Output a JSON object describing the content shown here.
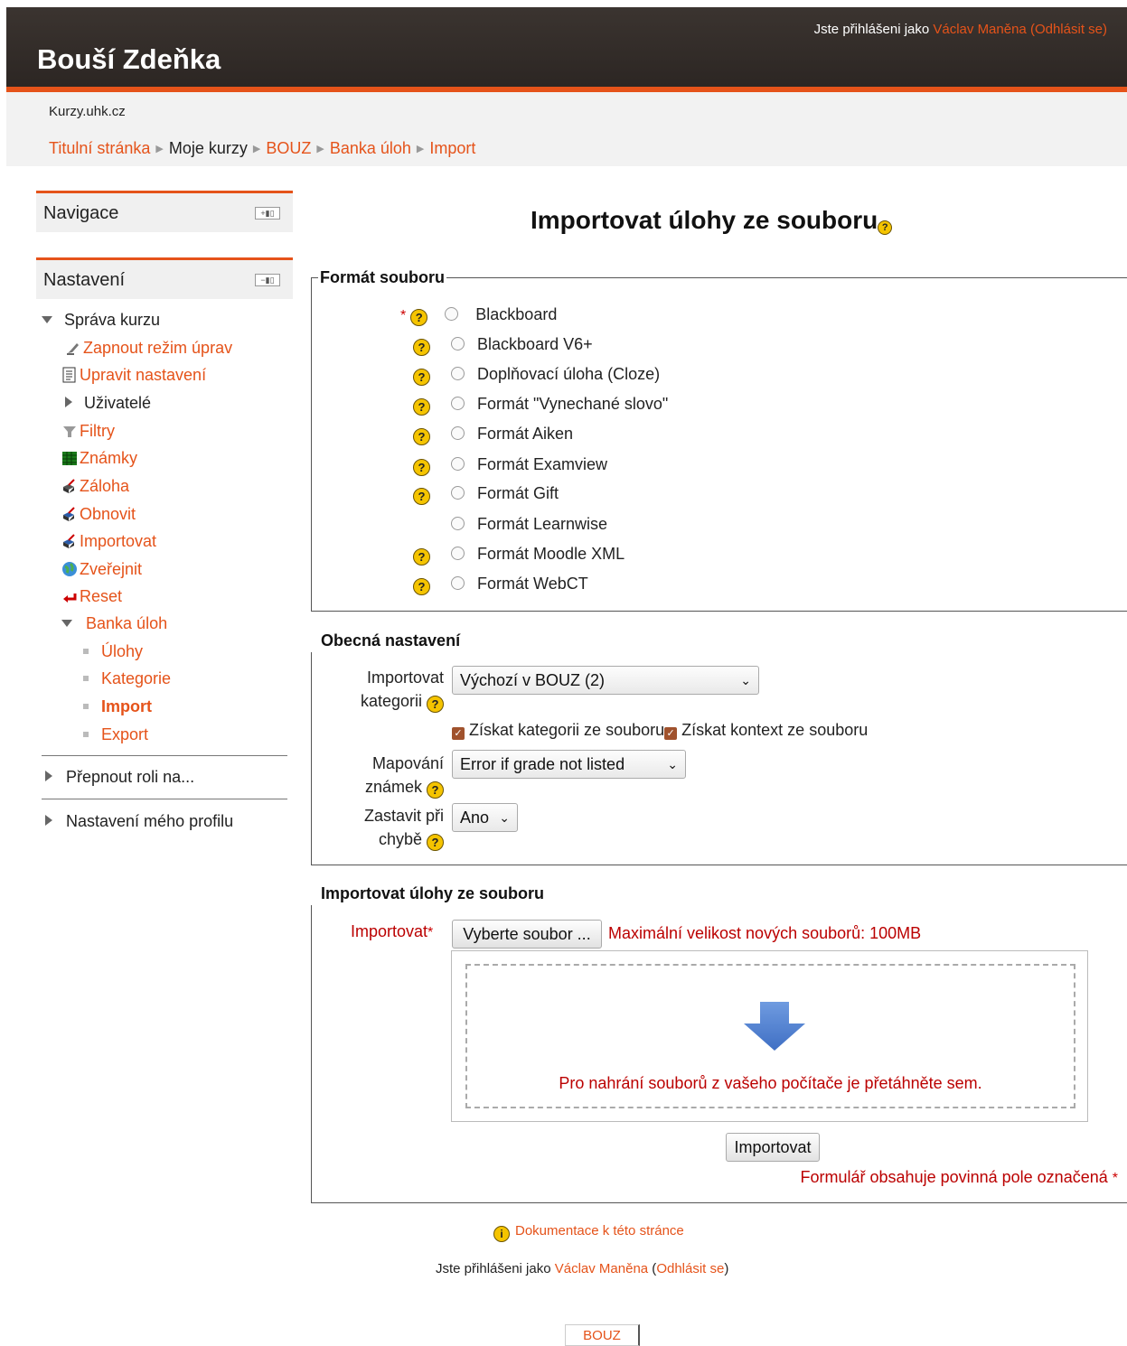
{
  "header": {
    "site_title": "Bouší Zdeňka",
    "login_prefix": "Jste přihlášeni jako ",
    "user_name": "Václav Maněna",
    "logout_open": "(",
    "logout": "Odhlásit se",
    "logout_close": ")"
  },
  "site_short": "Kurzy.uhk.cz",
  "breadcrumb": [
    "Titulní stránka",
    "Moje kurzy",
    "BOUZ",
    "Banka úloh",
    "Import"
  ],
  "blocks": {
    "navigation_title": "Navigace",
    "settings_title": "Nastavení",
    "settings_tree": {
      "course_admin": "Správa kurzu",
      "items": [
        "Zapnout režim úprav",
        "Upravit nastavení",
        "Uživatelé",
        "Filtry",
        "Známky",
        "Záloha",
        "Obnovit",
        "Importovat",
        "Zveřejnit",
        "Reset"
      ],
      "question_bank": "Banka úloh",
      "qb_items": [
        "Úlohy",
        "Kategorie",
        "Import",
        "Export"
      ],
      "switch_role": "Přepnout roli na...",
      "profile_settings": "Nastavení mého profilu"
    }
  },
  "page": {
    "title": "Importovat úlohy ze souboru",
    "file_format": {
      "legend": "Formát souboru",
      "options": [
        "Blackboard",
        "Blackboard V6+",
        "Doplňovací úloha (Cloze)",
        "Formát \"Vynechané slovo\"",
        "Formát Aiken",
        "Formát Examview",
        "Formát Gift",
        "Formát Learnwise",
        "Formát Moodle XML",
        "Formát WebCT"
      ]
    },
    "general": {
      "legend": "Obecná nastavení",
      "import_category_label_1": "Importovat",
      "import_category_label_2": "kategorii",
      "import_category_value": "Výchozí v BOUZ (2)",
      "get_category_from_file": "Získat kategorii ze souboru",
      "get_context_from_file": "Získat kontext ze souboru",
      "grade_map_label_1": "Mapování",
      "grade_map_label_2": "známek",
      "grade_map_value": "Error if grade not listed",
      "stop_on_error_label_1": "Zastavit při",
      "stop_on_error_label_2": "chybě",
      "stop_on_error_value": "Ano"
    },
    "import_section": {
      "legend": "Importovat úlohy ze souboru",
      "import_label": "Importovat",
      "choose_file": "Vyberte soubor ...",
      "max_size": "Maximální velikost nových souborů: 100MB",
      "drop_hint": "Pro nahrání souborů z vašeho počítače je přetáhněte sem.",
      "submit": "Importovat",
      "required_note": "Formulář obsahuje povinná pole označená"
    }
  },
  "footer": {
    "docs_link": "Dokumentace k této stránce",
    "login_prefix": "Jste přihlášeni jako ",
    "user_name": "Václav Maněna",
    "logout": "Odhlásit se",
    "course_button": "BOUZ"
  },
  "colors": {
    "accent": "#e5531a",
    "header_bg": "#2c2623",
    "error_red": "#b00000",
    "help_yellow": "#f5c400"
  }
}
